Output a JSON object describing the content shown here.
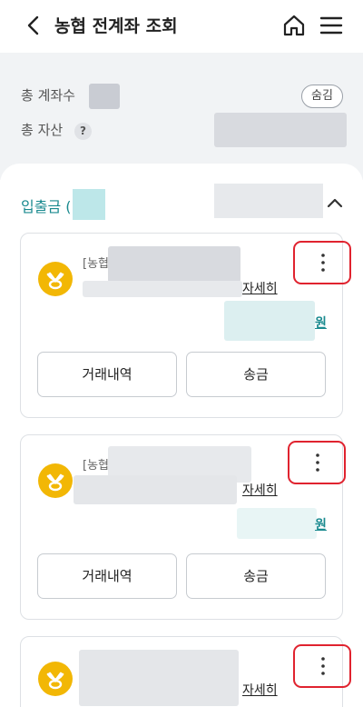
{
  "header": {
    "title": "농협 전계좌 조회"
  },
  "summary": {
    "total_accounts_label": "총 계좌수",
    "total_assets_label": "총 자산",
    "help_symbol": "?",
    "hide_button": "숨김"
  },
  "section": {
    "title": "입출금 ("
  },
  "accounts": [
    {
      "bank_label": "[농협",
      "detail_link": "자세히",
      "currency_unit": "원",
      "history_button": "거래내역",
      "transfer_button": "송금"
    },
    {
      "bank_label": "[농협",
      "detail_link": "자세히",
      "currency_unit": "원",
      "history_button": "거래내역",
      "transfer_button": "송금"
    },
    {
      "detail_link": "자세히"
    }
  ],
  "colors": {
    "accent": "#1a8a8f",
    "logo": "#f2b705",
    "highlight_border": "#e0232f"
  }
}
